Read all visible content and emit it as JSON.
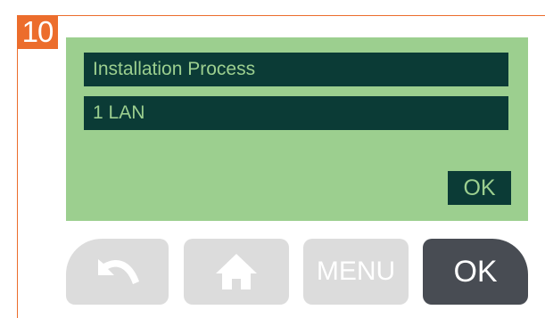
{
  "step": {
    "number": "10"
  },
  "screen": {
    "title": "Installation Process",
    "selected_item": "1 LAN",
    "ok_label": "OK"
  },
  "buttons": {
    "back_icon": "back-arrow-icon",
    "home_icon": "home-icon",
    "menu_label": "MENU",
    "ok_label": "OK"
  },
  "colors": {
    "accent_orange": "#ec6d2c",
    "screen_bg": "#9ccf8f",
    "screen_dark": "#0b3b36",
    "button_light": "#dcdcdc",
    "button_dark": "#484c53"
  }
}
